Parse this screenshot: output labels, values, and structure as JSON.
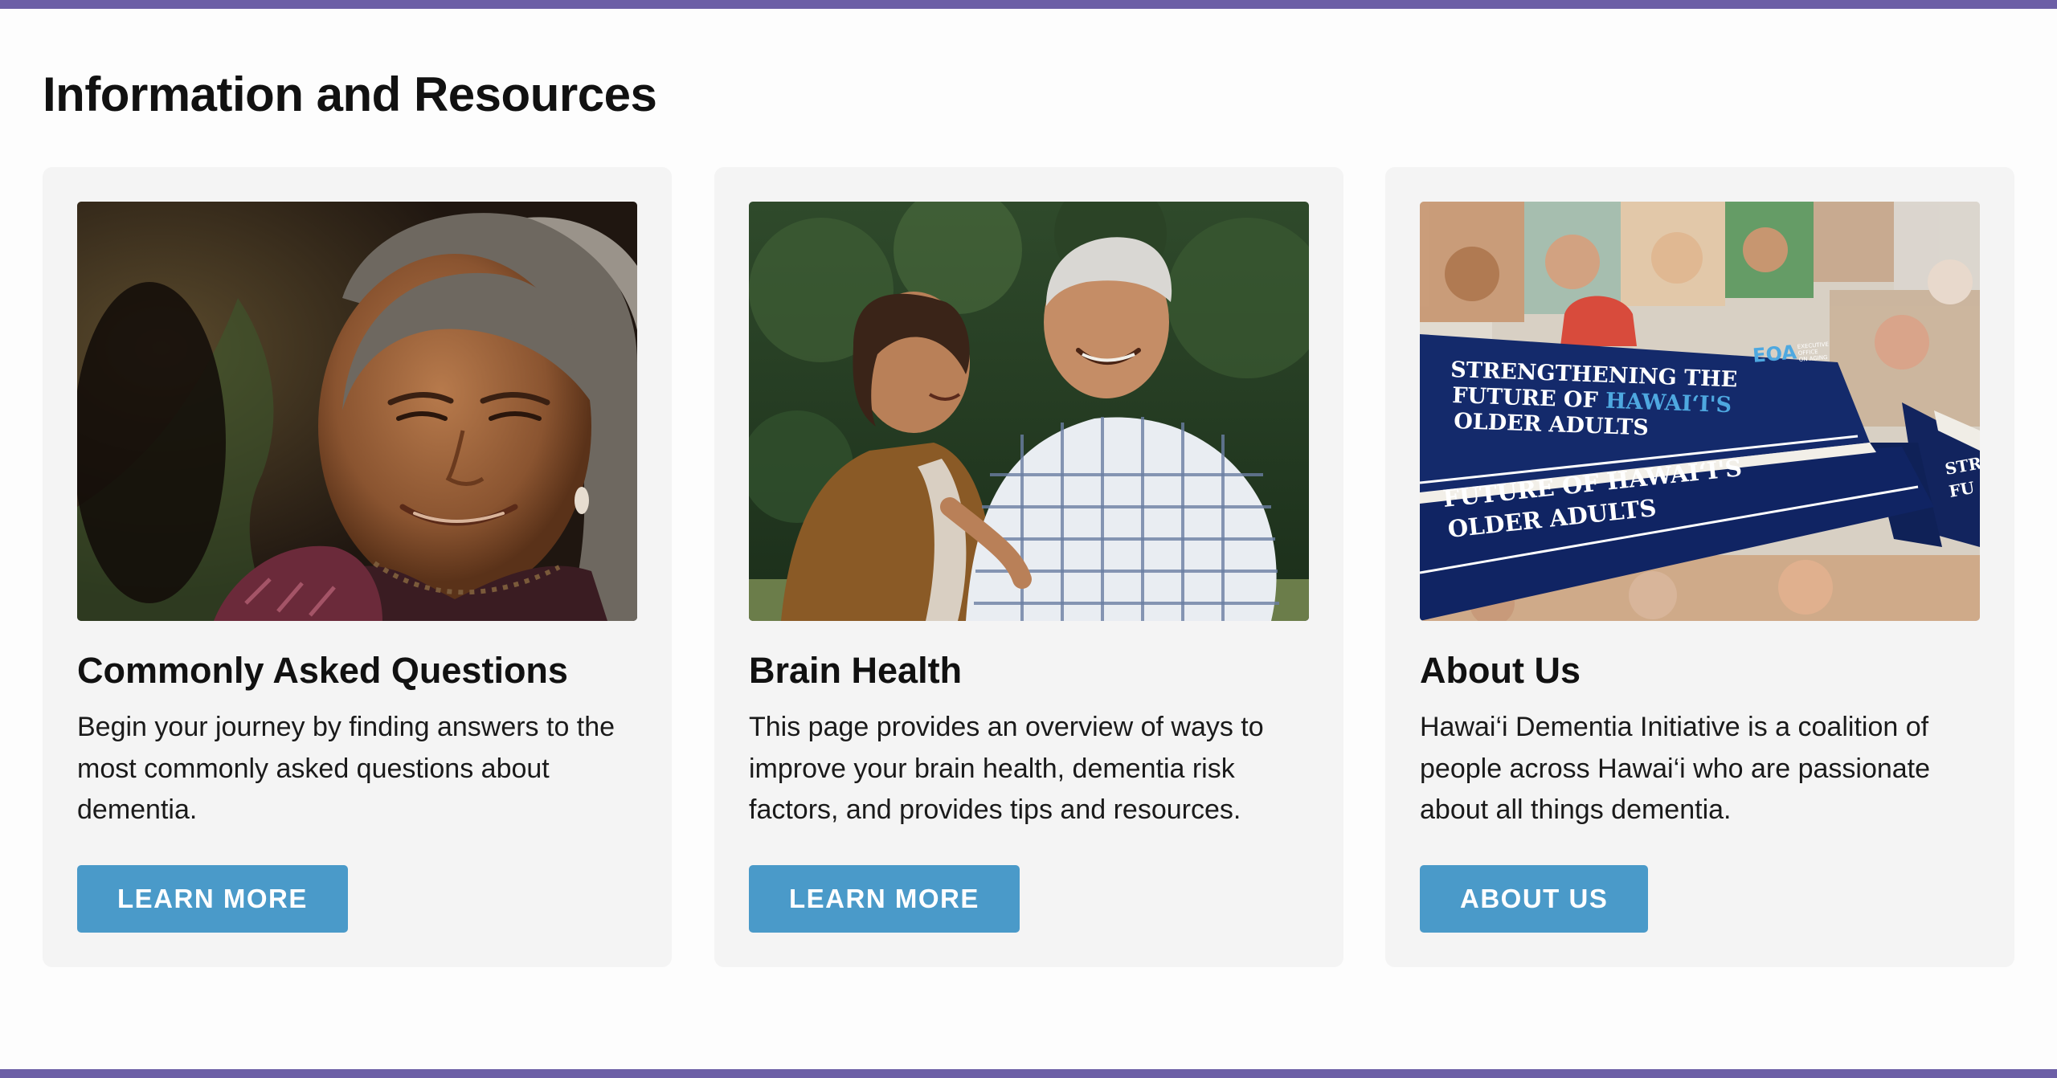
{
  "colors": {
    "accent_bar": "#6c5fa6",
    "button": "#4a9ac9",
    "card_bg": "#f4f4f4"
  },
  "section": {
    "title": "Information and Resources"
  },
  "cards": [
    {
      "title": "Commonly Asked Questions",
      "text": "Begin your journey by finding answers to the most commonly asked questions about dementia.",
      "button": "LEARN MORE"
    },
    {
      "title": "Brain Health",
      "text": "This page provides an overview of ways to improve your brain health, dementia risk factors, and provides tips and resources.",
      "button": "LEARN MORE"
    },
    {
      "title": "About Us",
      "text": "Hawai‘i Dementia Initiative is a coalition of people across Hawai‘i who are passionate about all things dementia.",
      "button": "ABOUT US",
      "image_text": {
        "line1": "STRENGTHENING THE",
        "line2a": "FUTURE OF ",
        "line2b": "HAWAI‘I'S",
        "line3": "OLDER ADULTS",
        "logo": "EOA",
        "logo_sub1": "EXECUTIVE",
        "logo_sub2": "OFFICE",
        "logo_sub3": "ON AGING",
        "lower_line1": "FUTURE OF HAWAI‘I'S",
        "lower_line2": "OLDER ADULTS",
        "side1": "STR",
        "side2": "FU"
      }
    }
  ]
}
